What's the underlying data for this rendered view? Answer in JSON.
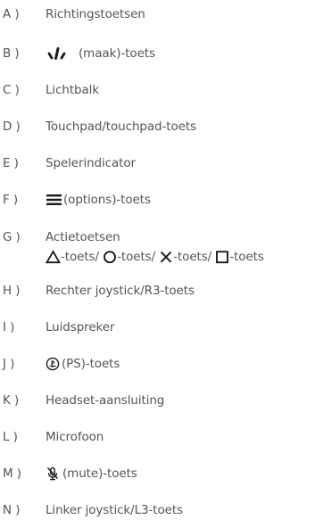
{
  "items": [
    {
      "letter": "A )",
      "text": "Richtingstoetsen"
    },
    {
      "letter": "B )",
      "icon": "create-icon",
      "text": "(maak)-toets"
    },
    {
      "letter": "C )",
      "text": "Lichtbalk"
    },
    {
      "letter": "D )",
      "text": "Touchpad/touchpad-toets"
    },
    {
      "letter": "E )",
      "text": "Spelerindicator"
    },
    {
      "letter": "F )",
      "icon": "options-icon",
      "text": "(options)-toets"
    },
    {
      "letter": "G )",
      "text": "Actietoetsen",
      "buttons": [
        {
          "icon": "triangle-icon",
          "text": "-toets/ "
        },
        {
          "icon": "circle-icon",
          "text": "-toets/ "
        },
        {
          "icon": "cross-icon",
          "text": "-toets/ "
        },
        {
          "icon": "square-icon",
          "text": "-toets"
        }
      ]
    },
    {
      "letter": "H )",
      "text": "Rechter joystick/R3-toets"
    },
    {
      "letter": "I )",
      "text": "Luidspreker"
    },
    {
      "letter": "J )",
      "icon": "ps-logo-icon",
      "text": "(PS)-toets"
    },
    {
      "letter": "K )",
      "text": "Headset-aansluiting"
    },
    {
      "letter": "L )",
      "text": "Microfoon"
    },
    {
      "letter": "M )",
      "icon": "mute-microphone-icon",
      "text": "(mute)-toets"
    },
    {
      "letter": "N )",
      "text": "Linker joystick/L3-toets"
    }
  ],
  "colors": {
    "text": "#555555",
    "icon": "#1a1a1a"
  }
}
